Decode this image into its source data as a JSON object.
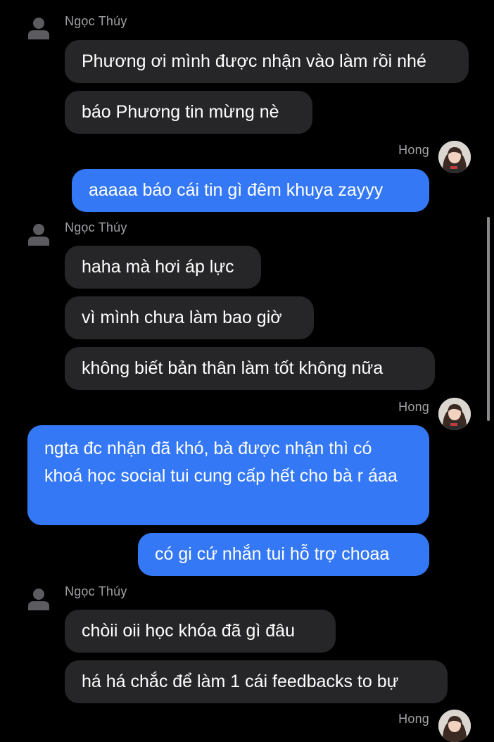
{
  "contacts": {
    "other_name": "Ngọc Thúy",
    "self_name": "Hong"
  },
  "messages": [
    "Phương ơi mình được nhận vào làm rồi nhé",
    "báo Phương tin mừng nè",
    "aaaaa báo cái tin gì đêm khuya zayyy",
    "haha mà hơi áp lực",
    "vì mình chưa làm bao giờ",
    "không biết bản thân làm tốt không nữa",
    "ngta đc nhận đã khó, bà được nhận thì có khoá học social tui cung cấp hết cho bà r áaa",
    "có gi cứ nhắn tui hỗ trợ choaa",
    "chòii oii học khóa đã gì đâu",
    "há há chắc để làm 1 cái feedbacks to bự"
  ],
  "icons": {
    "generic_avatar": "person-silhouette-icon",
    "self_avatar": "profile-photo"
  },
  "colors": {
    "background": "#000000",
    "incoming_bubble": "#262628",
    "outgoing_bubble": "#3478f6",
    "name_text": "#a0a0a5"
  }
}
